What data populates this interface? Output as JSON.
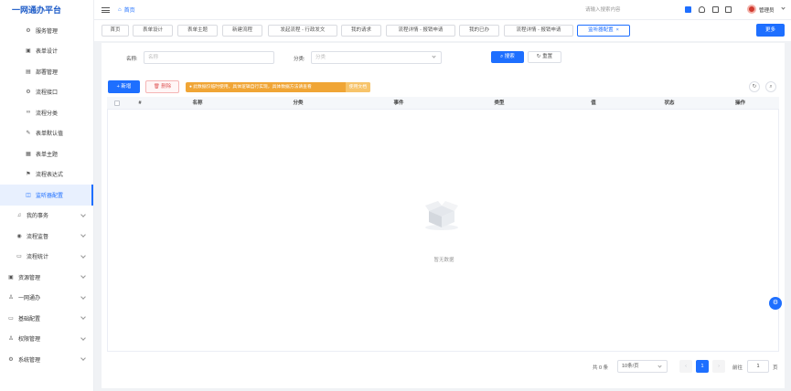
{
  "app": {
    "title": "一网通办平台"
  },
  "sidebar": {
    "items": [
      {
        "label": "服务管理",
        "icon": "gear-icon",
        "glyph": "⚙",
        "level": "sub"
      },
      {
        "label": "表单设计",
        "icon": "form-icon",
        "glyph": "▣",
        "level": "sub"
      },
      {
        "label": "部署管理",
        "icon": "chart-icon",
        "glyph": "▤",
        "level": "sub"
      },
      {
        "label": "流程接口",
        "icon": "cog-icon",
        "glyph": "⚙",
        "level": "sub"
      },
      {
        "label": "流程分类",
        "icon": "link-icon",
        "glyph": "∞",
        "level": "sub"
      },
      {
        "label": "表单默认值",
        "icon": "pencil-icon",
        "glyph": "✎",
        "level": "sub"
      },
      {
        "label": "表单主题",
        "icon": "theme-icon",
        "glyph": "▦",
        "level": "sub"
      },
      {
        "label": "流程表达式",
        "icon": "flag-icon",
        "glyph": "⚑",
        "level": "sub"
      },
      {
        "label": "监听器配置",
        "icon": "listener-icon",
        "glyph": "◫",
        "level": "sub",
        "active": true
      },
      {
        "label": "我的事务",
        "icon": "bell-icon",
        "glyph": "♫",
        "level": "section"
      },
      {
        "label": "流程监督",
        "icon": "eye-icon",
        "glyph": "◉",
        "level": "section"
      },
      {
        "label": "流程统计",
        "icon": "stats-icon",
        "glyph": "▭",
        "level": "section"
      },
      {
        "label": "资源管理",
        "icon": "resource-icon",
        "glyph": "▣",
        "level": "top"
      },
      {
        "label": "一网通办",
        "icon": "user-icon",
        "glyph": "♙",
        "level": "top"
      },
      {
        "label": "基础配置",
        "icon": "config-icon",
        "glyph": "▭",
        "level": "top"
      },
      {
        "label": "权限管理",
        "icon": "permission-icon",
        "glyph": "♙",
        "level": "top"
      },
      {
        "label": "系统管理",
        "icon": "system-icon",
        "glyph": "⚙",
        "level": "top"
      }
    ]
  },
  "header": {
    "breadcrumb_home": "首页",
    "search_placeholder": "请输入搜索内容",
    "user_name": "管理员"
  },
  "tabs": [
    {
      "label": "首页"
    },
    {
      "label": "表单设计"
    },
    {
      "label": "表单主题"
    },
    {
      "label": "新建流程"
    },
    {
      "label": "发起流程 - 行政发文"
    },
    {
      "label": "我的请求"
    },
    {
      "label": "流程详情 - 报销申请"
    },
    {
      "label": "我的已办"
    },
    {
      "label": "流程详情 - 报销申请"
    },
    {
      "label": "监听器配置",
      "active": true,
      "close": "×"
    }
  ],
  "more_label": "更多",
  "filters": {
    "name_label": "名称:",
    "name_placeholder": "名称",
    "category_label": "分类:",
    "category_placeholder": "分类",
    "search_label": "搜索",
    "reset_label": "重置"
  },
  "toolbar": {
    "add_label": "新增",
    "delete_label": "删除",
    "notice": "此数据仅临时使用，具体逻辑自行实现，具体数据方法请查看",
    "doc_link": "使用文档"
  },
  "table": {
    "columns": [
      "#",
      "名称",
      "分类",
      "事件",
      "类型",
      "值",
      "状态",
      "操作"
    ],
    "empty_text": "暂无数据"
  },
  "pagination": {
    "total": "共 0 条",
    "page_size": "10条/页",
    "current_page": "1",
    "goto_label": "前往",
    "goto_value": "1",
    "page_unit": "页",
    "prev": "‹",
    "next": "›"
  },
  "colors": {
    "accent": "#1e6fff",
    "warning": "#f0a535",
    "danger": "#e05a5a"
  }
}
